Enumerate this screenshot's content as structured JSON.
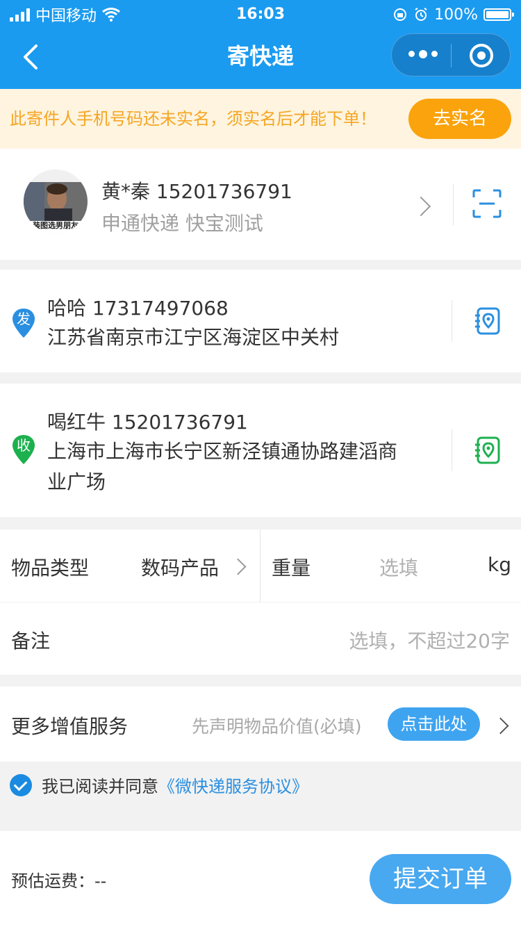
{
  "status_bar": {
    "carrier": "中国移动",
    "time": "16:03",
    "battery": "100%"
  },
  "nav": {
    "title": "寄快递"
  },
  "banner": {
    "message": "此寄件人手机号码还未实名，须实名后才能下单！",
    "button": "去实名"
  },
  "sender_profile": {
    "avatar_caption": "装图选男朋友",
    "name_phone": "黄*秦  15201736791",
    "company": "申通快递  快宝测试"
  },
  "from": {
    "tag": "发",
    "name_phone": "哈哈 17317497068",
    "address": "江苏省南京市江宁区海淀区中关村"
  },
  "to": {
    "tag": "收",
    "name_phone": "喝红牛 15201736791",
    "address_line1": "上海市上海市长宁区新泾镇通协路建滔商",
    "address_line2": "业广场"
  },
  "item": {
    "type_label": "物品类型",
    "type_value": "数码产品",
    "weight_label": "重量",
    "weight_placeholder": "选填",
    "weight_unit": "kg"
  },
  "remark": {
    "label": "备注",
    "placeholder": "选填，不超过20字"
  },
  "service": {
    "label": "更多增值服务",
    "hint": "先声明物品价值(必填)",
    "button": "点击此处"
  },
  "agreement": {
    "text": "我已阅读并同意",
    "link": "《微快递服务协议》"
  },
  "footer": {
    "fee_label": "预估运费：",
    "fee_value": "--",
    "submit": "提交订单"
  },
  "colors": {
    "brand_blue": "#1a9bf0",
    "warning_orange": "#fba30c",
    "from_pin": "#2a8fe0",
    "to_pin": "#1db04f"
  }
}
